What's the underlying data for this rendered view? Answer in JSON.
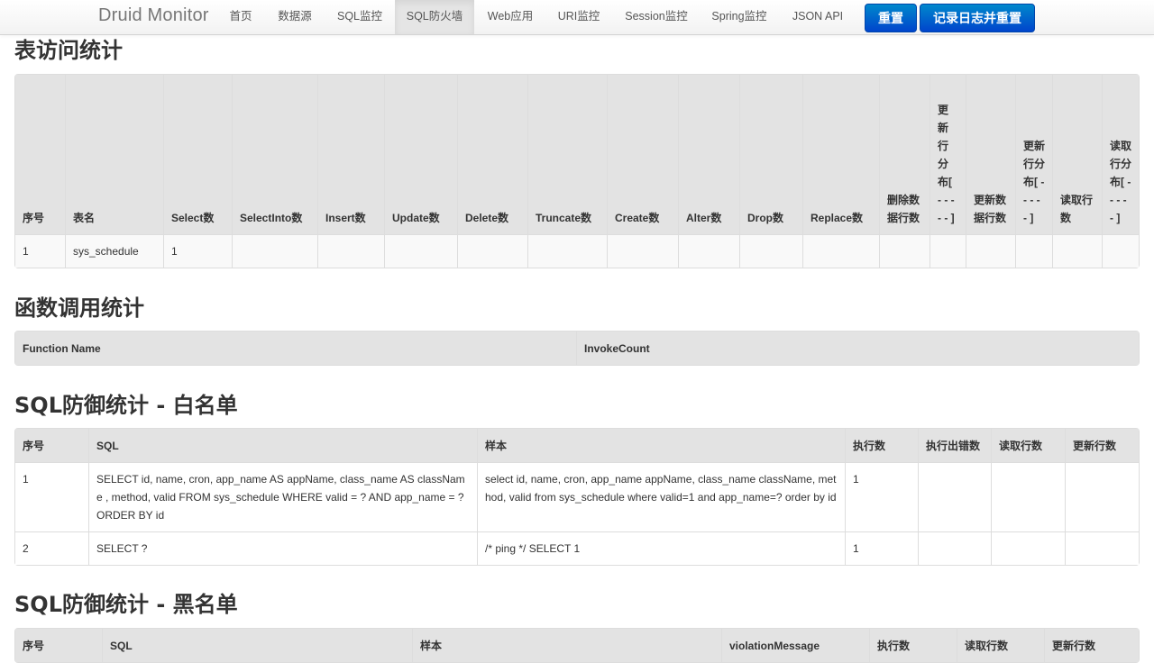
{
  "navbar": {
    "brand": "Druid Monitor",
    "items": [
      {
        "label": "首页",
        "active": false
      },
      {
        "label": "数据源",
        "active": false
      },
      {
        "label": "SQL监控",
        "active": false
      },
      {
        "label": "SQL防火墙",
        "active": true
      },
      {
        "label": "Web应用",
        "active": false
      },
      {
        "label": "URI监控",
        "active": false
      },
      {
        "label": "Session监控",
        "active": false
      },
      {
        "label": "Spring监控",
        "active": false
      },
      {
        "label": "JSON API",
        "active": false
      }
    ],
    "reset_button": "重置",
    "log_reset_button": "记录日志并重置"
  },
  "table_access": {
    "title": "表访问统计",
    "headers": [
      "序号",
      "表名",
      "Select数",
      "SelectInto数",
      "Insert数",
      "Update数",
      "Delete数",
      "Truncate数",
      "Create数",
      "Alter数",
      "Drop数",
      "Replace数",
      "删除数据行数",
      "更新行分布[ - - - - - ]",
      "更新数据行数",
      "更新行分布[ - - - - - ]",
      "读取行数",
      "读取行分布[ - - - - - ]"
    ],
    "rows": [
      [
        "1",
        "sys_schedule",
        "1",
        "",
        "",
        "",
        "",
        "",
        "",
        "",
        "",
        "",
        "",
        "",
        "",
        "",
        "",
        ""
      ]
    ]
  },
  "table_function": {
    "title": "函数调用统计",
    "headers": [
      "Function Name",
      "InvokeCount"
    ],
    "rows": []
  },
  "table_whitelist": {
    "title": "SQL防御统计 - 白名单",
    "headers": [
      "序号",
      "SQL",
      "样本",
      "执行数",
      "执行出错数",
      "读取行数",
      "更新行数"
    ],
    "rows": [
      [
        "1",
        "SELECT id, name, cron, app_name AS appName, class_name AS className , method, valid FROM sys_schedule WHERE valid = ? AND app_name = ? ORDER BY id",
        "select id, name, cron, app_name appName, class_name className, method, valid from sys_schedule where valid=1 and app_name=? order by id",
        "1",
        "",
        "",
        ""
      ],
      [
        "2",
        "SELECT ?",
        "/* ping */ SELECT 1",
        "1",
        "",
        "",
        ""
      ]
    ]
  },
  "table_blacklist": {
    "title": "SQL防御统计 - 黑名单",
    "headers": [
      "序号",
      "SQL",
      "样本",
      "violationMessage",
      "执行数",
      "读取行数",
      "更新行数"
    ],
    "rows": []
  },
  "colors": {
    "nav_bg": "#f5f5f5",
    "header_bg": "#e3e3e3",
    "button_blue": "#0066cc",
    "border": "#dddddd"
  }
}
